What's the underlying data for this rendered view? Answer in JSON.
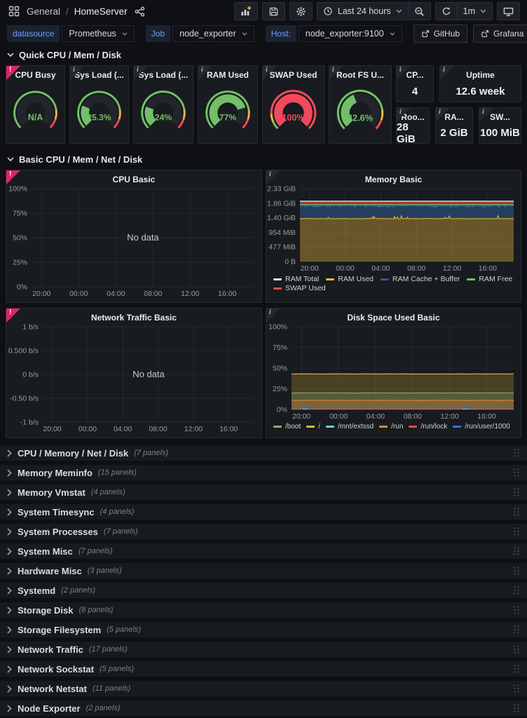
{
  "nav": {
    "section": "General",
    "separator": "/",
    "title": "HomeServer",
    "time_label": "Last 24 hours",
    "refresh_label": "1m"
  },
  "variables": [
    {
      "label": "datasource",
      "value": "Prometheus"
    },
    {
      "label": "Job",
      "value": "node_exporter"
    },
    {
      "label": "Host:",
      "value": "node_exporter:9100"
    }
  ],
  "link_buttons": [
    {
      "label": "GitHub"
    },
    {
      "label": "Grafana"
    }
  ],
  "sections": {
    "quick": "Quick CPU / Mem / Disk",
    "basic": "Basic CPU / Mem / Net / Disk"
  },
  "no_data_text": "No data",
  "colors": {
    "gauge_green": "#73BF69",
    "gauge_red": "#F2495C",
    "threshold_orange": "#EAB839",
    "error_pink": "#E0226C",
    "accent_blue": "#6E9FFF"
  },
  "gauge_panels": [
    {
      "title": "CPU Busy",
      "display": "N/A",
      "value": null,
      "badge": "error",
      "color": "#73BF69",
      "thresholds": [
        80,
        90
      ]
    },
    {
      "title": "Sys Load (...",
      "display": "25.3%",
      "value": 25.3,
      "badge": "info",
      "color": "#73BF69",
      "thresholds": [
        80,
        90
      ]
    },
    {
      "title": "Sys Load (...",
      "display": "24%",
      "value": 24,
      "badge": "info",
      "color": "#73BF69",
      "thresholds": [
        80,
        90
      ]
    },
    {
      "title": "RAM Used",
      "display": "77%",
      "value": 77,
      "badge": "info",
      "color": "#73BF69",
      "thresholds": [
        80,
        90
      ]
    },
    {
      "title": "SWAP Used",
      "display": "100%",
      "value": 100,
      "badge": "info",
      "color": "#F2495C",
      "thresholds": [
        8,
        16
      ]
    },
    {
      "title": "Root FS U...",
      "display": "42.6%",
      "value": 42.6,
      "badge": "info",
      "color": "#73BF69",
      "thresholds": [
        80,
        90
      ]
    }
  ],
  "stat_rows": {
    "top": [
      {
        "title": "CP...",
        "value": "4"
      },
      {
        "title": "Uptime",
        "value": "12.6 week"
      }
    ],
    "bottom": [
      {
        "title": "Roo...",
        "value": "28 GiB"
      },
      {
        "title": "RA...",
        "value": "2 GiB"
      },
      {
        "title": "SW...",
        "value": "100 MiB"
      }
    ]
  },
  "chart_data": [
    {
      "id": "cpu",
      "type": "line",
      "title": "CPU Basic",
      "no_data": true,
      "badge": "error",
      "grid": true,
      "x_ticks": [
        "20:00",
        "00:00",
        "04:00",
        "08:00",
        "12:00",
        "16:00"
      ],
      "y_ticks": [
        "0%",
        "25%",
        "50%",
        "75%",
        "100%"
      ],
      "ylim": [
        0,
        100
      ],
      "x_range": "Last 24 hours"
    },
    {
      "id": "memory",
      "type": "area",
      "stacked": true,
      "title": "Memory Basic",
      "badge": "info",
      "grid": true,
      "x_ticks": [
        "20:00",
        "00:00",
        "04:00",
        "08:00",
        "12:00",
        "16:00"
      ],
      "y_ticks": [
        "0 B",
        "477 MiB",
        "954 MiB",
        "1.40 GiB",
        "1.86 GiB",
        "2.33 GiB"
      ],
      "ylim_gib": [
        0,
        2.33
      ],
      "x_range": "Last 24 hours",
      "series": [
        {
          "name": "RAM Total",
          "color": "#DEDFE1",
          "style": "line",
          "value_gib": 1.92
        },
        {
          "name": "RAM Used",
          "color": "#EAB839",
          "style": "area",
          "value_gib": 1.37
        },
        {
          "name": "RAM Cache + Buffer",
          "color": "#31598C",
          "style": "area",
          "value_gib": 0.43
        },
        {
          "name": "RAM Free",
          "color": "#73BF69",
          "style": "area",
          "value_gib": 0.04
        },
        {
          "name": "SWAP Used",
          "color": "#E24D42",
          "style": "area",
          "value_gib": 0.1
        }
      ],
      "legend_rows": [
        [
          "RAM Total",
          "RAM Used",
          "RAM Cache + Buffer",
          "RAM Free"
        ],
        [
          "SWAP Used"
        ]
      ]
    },
    {
      "id": "network",
      "type": "line",
      "title": "Network Traffic Basic",
      "no_data": true,
      "badge": "error",
      "grid": true,
      "x_ticks": [
        "20:00",
        "00:00",
        "04:00",
        "08:00",
        "12:00",
        "16:00"
      ],
      "y_ticks": [
        "-1 b/s",
        "-0.50 b/s",
        "0 b/s",
        "0.500 b/s",
        "1 b/s"
      ],
      "ylim": [
        -1,
        1
      ],
      "x_range": "Last 24 hours"
    },
    {
      "id": "disk",
      "type": "line",
      "title": "Disk Space Used Basic",
      "badge": "info",
      "grid": true,
      "x_ticks": [
        "20:00",
        "00:00",
        "04:00",
        "08:00",
        "12:00",
        "16:00"
      ],
      "y_ticks": [
        "0%",
        "25%",
        "50%",
        "75%",
        "100%"
      ],
      "ylim": [
        0,
        100
      ],
      "x_range": "Last 24 hours",
      "series": [
        {
          "name": "/boot",
          "color": "#7EB26D",
          "value_pct": 20
        },
        {
          "name": "/",
          "color": "#EAB839",
          "value_pct": 43
        },
        {
          "name": "/mnt/extssd",
          "color": "#6ED0E0",
          "value_pct": 0.45
        },
        {
          "name": "/run",
          "color": "#EF843C",
          "value_pct": 11
        },
        {
          "name": "/run/lock",
          "color": "#E24D42",
          "value_pct": 0.85
        },
        {
          "name": "/run/user/1000",
          "color": "#3274D9",
          "value_pct": 0.25
        }
      ],
      "legend_rows": [
        [
          "/boot",
          "/",
          "/mnt/extssd",
          "/run",
          "/run/lock",
          "/run/user/1000"
        ]
      ]
    }
  ],
  "collapsed_rows": [
    {
      "title": "CPU / Memory / Net / Disk",
      "count": "(7 panels)"
    },
    {
      "title": "Memory Meminfo",
      "count": "(15 panels)"
    },
    {
      "title": "Memory Vmstat",
      "count": "(4 panels)"
    },
    {
      "title": "System Timesync",
      "count": "(4 panels)"
    },
    {
      "title": "System Processes",
      "count": "(7 panels)"
    },
    {
      "title": "System Misc",
      "count": "(7 panels)"
    },
    {
      "title": "Hardware Misc",
      "count": "(3 panels)"
    },
    {
      "title": "Systemd",
      "count": "(2 panels)"
    },
    {
      "title": "Storage Disk",
      "count": "(8 panels)"
    },
    {
      "title": "Storage Filesystem",
      "count": "(5 panels)"
    },
    {
      "title": "Network Traffic",
      "count": "(17 panels)"
    },
    {
      "title": "Network Sockstat",
      "count": "(5 panels)"
    },
    {
      "title": "Network Netstat",
      "count": "(11 panels)"
    },
    {
      "title": "Node Exporter",
      "count": "(2 panels)"
    }
  ]
}
